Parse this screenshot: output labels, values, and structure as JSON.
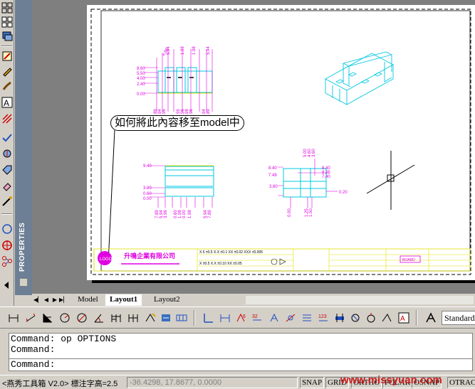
{
  "palette": {
    "title": "PROPERTIES"
  },
  "drawing": {
    "callout_text": "如何將此內容移至model中",
    "titleblock_company": "升鳴企業有限公司"
  },
  "tabs": {
    "items": [
      {
        "label": "Model",
        "active": false
      },
      {
        "label": "Layout1",
        "active": true
      },
      {
        "label": "Layout2",
        "active": false
      }
    ]
  },
  "dim_toolbar": {
    "style_value": "Standard"
  },
  "command": {
    "history": [
      "Command: op OPTIONS",
      "Command:"
    ],
    "prompt": "Command:"
  },
  "status": {
    "app_info": "<燕秀工具箱 V2.0> 標注字高=2.5",
    "coords": "-36.4298, 17.8677, 0.0000",
    "modes": [
      "SNAP",
      "GRID",
      "ORTHO",
      "POLAR",
      "OSNAP",
      "OTRAC"
    ],
    "watermark": "www.missyuan.com"
  },
  "colors": {
    "drawing_bg": "#7f7f7f",
    "paper": "#ffffff",
    "entity_magenta": "#e000e0",
    "entity_cyan": "#00c8e0",
    "entity_yellow": "#e0e000",
    "entity_red": "#e00000",
    "watermark": "#cc2020"
  }
}
